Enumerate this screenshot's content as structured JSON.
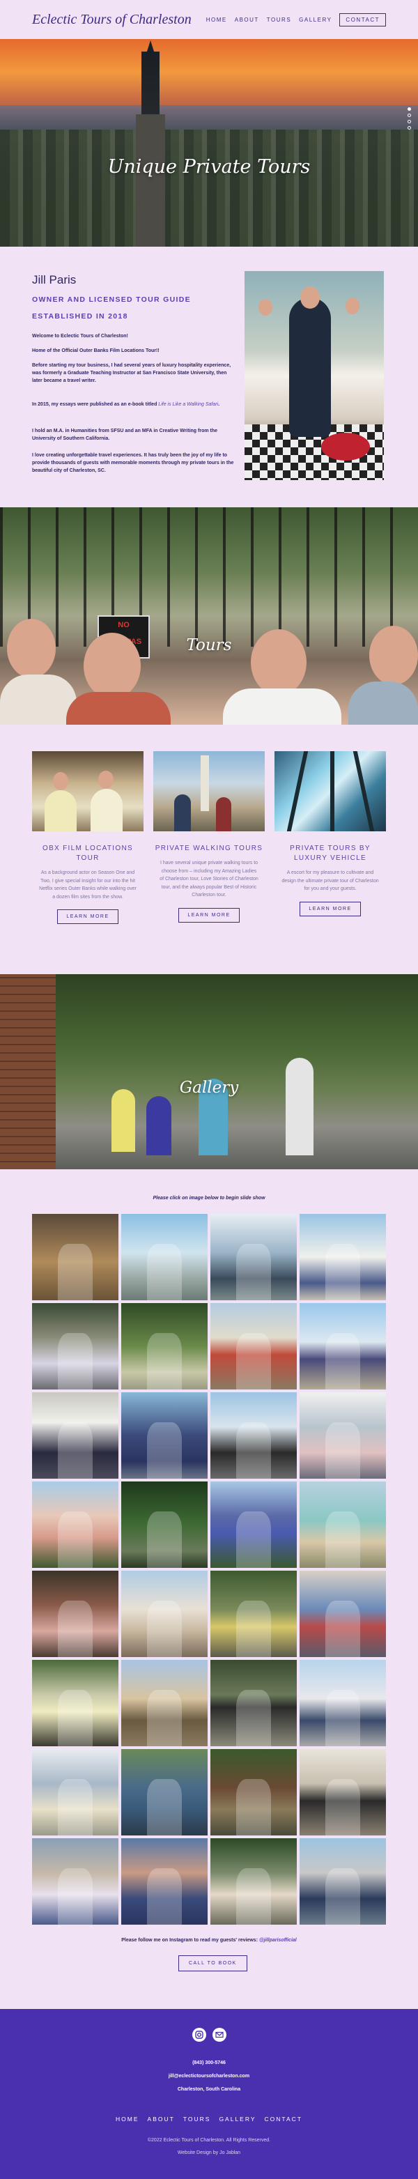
{
  "header": {
    "logo": "Eclectic Tours of Charleston",
    "nav": [
      "HOME",
      "ABOUT",
      "TOURS",
      "GALLERY"
    ],
    "contact": "CONTACT"
  },
  "hero": {
    "title": "Unique Private Tours",
    "slides": 4,
    "active_slide": 1
  },
  "about": {
    "name": "Jill Paris",
    "subtitle1": "OWNER AND LICENSED TOUR GUIDE",
    "subtitle2": "ESTABLISHED IN 2018",
    "p1": "Welcome to Eclectic Tours of Charleston!",
    "p2": "Home of the Official Outer Banks Film Locations Tour!!",
    "p3": "Before starting my tour business, I had several years of luxury hospitality experience, was formerly a Graduate Teaching Instructor at San Francisco State University, then later became a travel writer.",
    "p4_pre": "In 2015, my essays were published as an e-book titled ",
    "p4_link": "Life is Like a Walking Safari",
    "p4_post": ".",
    "p5": "I hold an M.A. in Humanities from SFSU and an MFA in Creative Writing from the University of Southern California.",
    "p6": "I love creating unforgettable travel experiences. It has truly been the joy of my life to provide thousands of guests with memorable moments through my private tours in the beautiful city of Charleston, SC."
  },
  "tours_banner": {
    "title": "Tours",
    "sign_line1": "NO",
    "sign_line2": "TRESPAS"
  },
  "tours": [
    {
      "title": "OBX FILM LOCATIONS TOUR",
      "text": "As a background actor on Season One and Two, I give special insight for our into the hit Netflix series Outer Banks while walking over a dozen film sites from the show.",
      "button": "LEARN MORE"
    },
    {
      "title": "PRIVATE WALKING TOURS",
      "text": "I have several unique private walking tours to choose from – including my Amazing Ladies of Charleston tour, Love Stories of Charleston tour, and the always popular Best of Historic Charleston tour.",
      "button": "LEARN MORE"
    },
    {
      "title": "PRIVATE TOURS BY LUXURY VEHICLE",
      "text": "A escort for my pleasure to cultivate and design the ultimate private tour of Charleston for you and your guests.",
      "button": "LEARN MORE"
    }
  ],
  "gallery_banner": {
    "title": "Gallery"
  },
  "gallery": {
    "caption": "Please click on image below to begin slide show",
    "images": 32,
    "instagram_text": "Please follow me on Instagram to read my guests' reviews: ",
    "instagram_handle": "@jillparisofficial",
    "call_button": "CALL TO BOOK"
  },
  "footer": {
    "phone": "(843) 300-5746",
    "email": "jill@eclectictoursofcharleston.com",
    "city": "Charleston, South Carolina",
    "nav": [
      "HOME",
      "ABOUT",
      "TOURS",
      "GALLERY",
      "CONTACT"
    ],
    "copyright": "©2022 Eclectic Tours of Charleston. All Rights Reserved.",
    "credit": "Website Design by Jo Jablan",
    "social_icons": [
      "instagram-icon",
      "email-icon"
    ]
  },
  "colors": {
    "accent": "#5a3fb4",
    "background": "#f1e3f5",
    "footer": "#4a2faf",
    "text": "#2f2560"
  }
}
